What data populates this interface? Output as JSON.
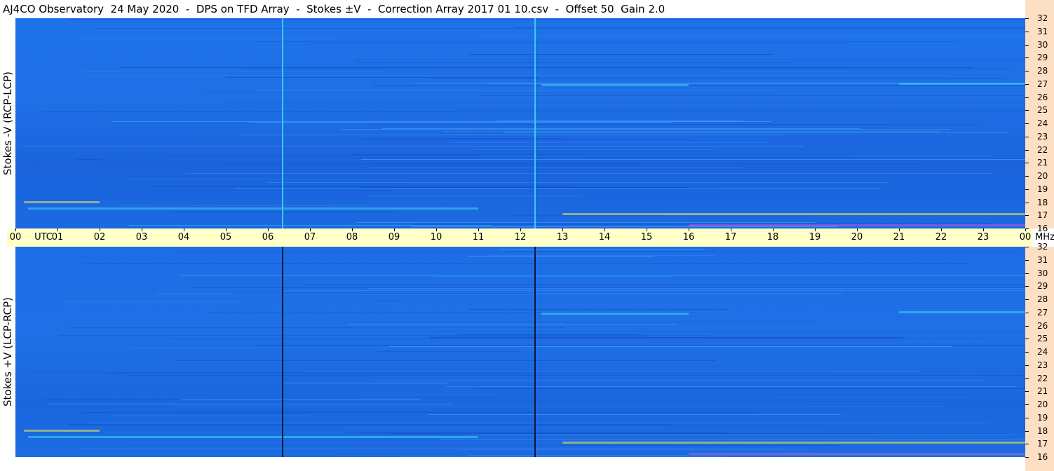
{
  "title": "AJ4CO Observatory  24 May 2020  -  DPS on TFD Array  -  Stokes ±V  -  Correction Array 2017 01 10.csv  -  Offset 50  Gain 2.0",
  "colors": {
    "background_blue": "#1e6fe6",
    "axis_band": "#ffffc8",
    "freq_axis_bg": "#fde0c4",
    "hot_yellow": "#f7e94a",
    "cyan": "#3cd8f0",
    "dark_line": "#0a1a3a"
  },
  "chart_data": [
    {
      "type": "heatmap",
      "ylabel": "Stokes -V (RCP-LCP)",
      "x_ticks": [
        "00",
        "01",
        "02",
        "03",
        "04",
        "05",
        "06",
        "07",
        "08",
        "09",
        "10",
        "11",
        "12",
        "13",
        "14",
        "15",
        "16",
        "17",
        "18",
        "19",
        "20",
        "21",
        "22",
        "23",
        "00"
      ],
      "x_axis_label_texts": [
        "UTC",
        "MHz"
      ],
      "xlim": [
        0,
        24
      ],
      "ylim": [
        16,
        32
      ],
      "y_ticks": [
        "16",
        "17",
        "18",
        "19",
        "20",
        "21",
        "22",
        "23",
        "24",
        "25",
        "26",
        "27",
        "28",
        "29",
        "30",
        "31",
        "32"
      ],
      "vertical_lines": [
        {
          "utc": 6.33,
          "color": "#3cc8f0"
        },
        {
          "utc": 12.33,
          "color": "#3cc8f0"
        }
      ]
    },
    {
      "type": "heatmap",
      "ylabel": "Stokes +V (LCP-RCP)",
      "x_ticks": [
        "00",
        "01",
        "02",
        "03",
        "04",
        "05",
        "06",
        "07",
        "08",
        "09",
        "10",
        "11",
        "12",
        "13",
        "14",
        "15",
        "16",
        "17",
        "18",
        "19",
        "20",
        "21",
        "22",
        "23",
        "00"
      ],
      "xlim": [
        0,
        24
      ],
      "ylim": [
        16,
        32
      ],
      "y_ticks": [
        "16",
        "17",
        "18",
        "19",
        "20",
        "21",
        "22",
        "23",
        "24",
        "25",
        "26",
        "27",
        "28",
        "29",
        "30",
        "31",
        "32"
      ],
      "vertical_lines": [
        {
          "utc": 6.33,
          "color": "#0a1a3a"
        },
        {
          "utc": 12.33,
          "color": "#0a1a3a"
        }
      ]
    }
  ],
  "axis_text": {
    "utc": "UTC",
    "mhz": "MHz"
  }
}
